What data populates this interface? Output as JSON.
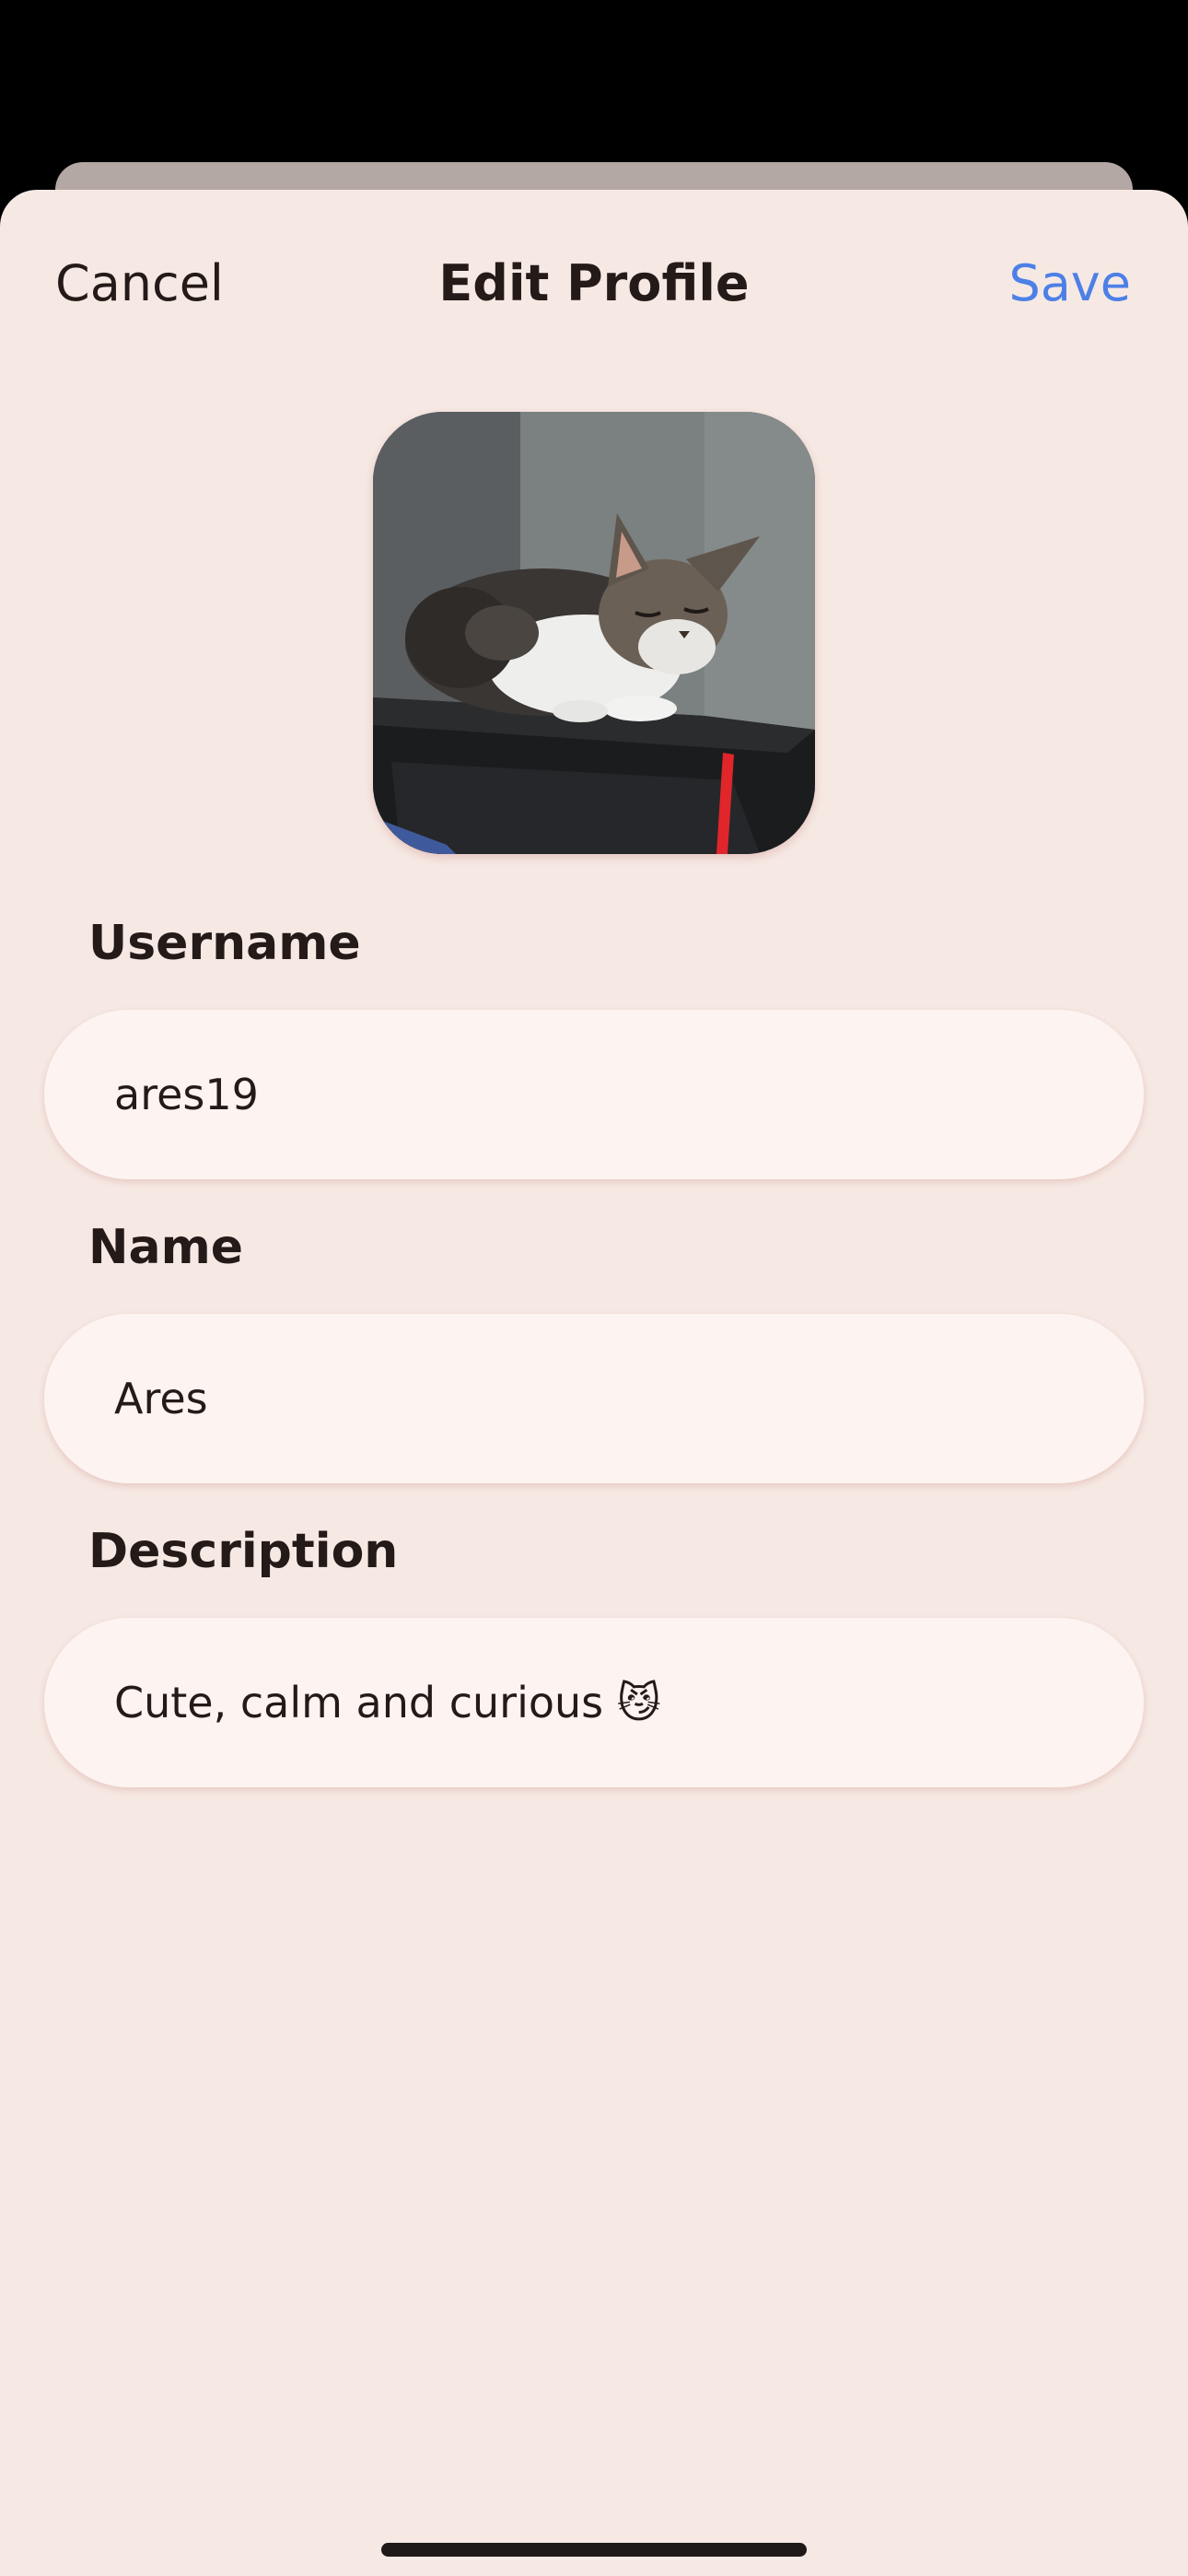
{
  "header": {
    "cancel_label": "Cancel",
    "title": "Edit Profile",
    "save_label": "Save"
  },
  "avatar": {
    "icon": "profile-photo-cat"
  },
  "fields": {
    "username": {
      "label": "Username",
      "value": "ares19"
    },
    "name": {
      "label": "Name",
      "value": "Ares"
    },
    "description": {
      "label": "Description",
      "value": "Cute, calm and curious 😼"
    }
  },
  "colors": {
    "accent": "#4d80e6",
    "sheet_background": "#f6e9e4",
    "field_background": "#fdf4f2",
    "text": "#241a18"
  }
}
